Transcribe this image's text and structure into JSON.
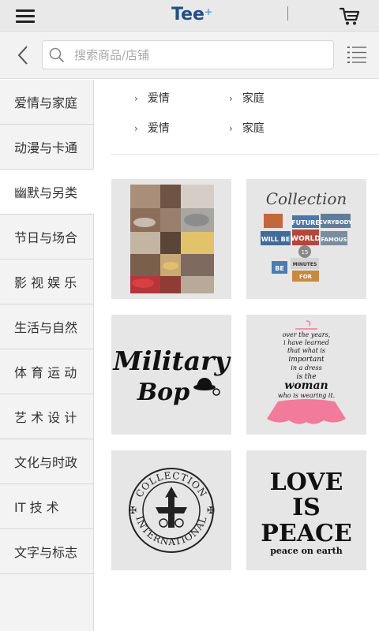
{
  "topbar": {
    "brand": "Tee",
    "brand_mark": "+"
  },
  "search": {
    "placeholder": "搜索商品/店铺",
    "value": ""
  },
  "sidebar": {
    "items": [
      {
        "label": "爱情与家庭"
      },
      {
        "label": "动漫与卡通"
      },
      {
        "label": "幽默与另类",
        "active": true
      },
      {
        "label": "节日与场合"
      },
      {
        "label": "影 视 娱 乐"
      },
      {
        "label": "生活与自然"
      },
      {
        "label": "体 育 运 动"
      },
      {
        "label": "艺 术 设 计"
      },
      {
        "label": "文化与时政"
      },
      {
        "label": "IT 技 术"
      },
      {
        "label": "文字与标志"
      }
    ]
  },
  "subcategories": [
    {
      "label": "爱情"
    },
    {
      "label": "家庭"
    },
    {
      "label": "爱情"
    },
    {
      "label": "家庭"
    }
  ],
  "products": {
    "p2": {
      "word1": "Collection",
      "word2": "FUTURE",
      "word3": "EVRYBODY",
      "word4": "WILL BE",
      "word5": "WORLD",
      "word6": "FAMOUS",
      "word7": "15",
      "word8": "MINUTES",
      "word9": "BE",
      "word10": "FOR"
    },
    "p3": {
      "line1": "Military",
      "line2": "Bop"
    },
    "p4": {
      "line1": "over the years,",
      "line2": "i have learned",
      "line3": "that what is",
      "line4": "important",
      "line5": "in a dress",
      "line6": "is the",
      "line7": "woman",
      "line8": "who is wearing it."
    },
    "p5": {
      "top": "COLLECTION",
      "bottom": "INTERNATIONAL"
    },
    "p6": {
      "line1": "LOVE",
      "line2": "IS",
      "line3": "PEACE",
      "line4": "peace on earth"
    }
  },
  "colors": {
    "brand": "#1f4f8a",
    "accent": "#4aa7e0",
    "dress_pink": "#f27a9a"
  }
}
